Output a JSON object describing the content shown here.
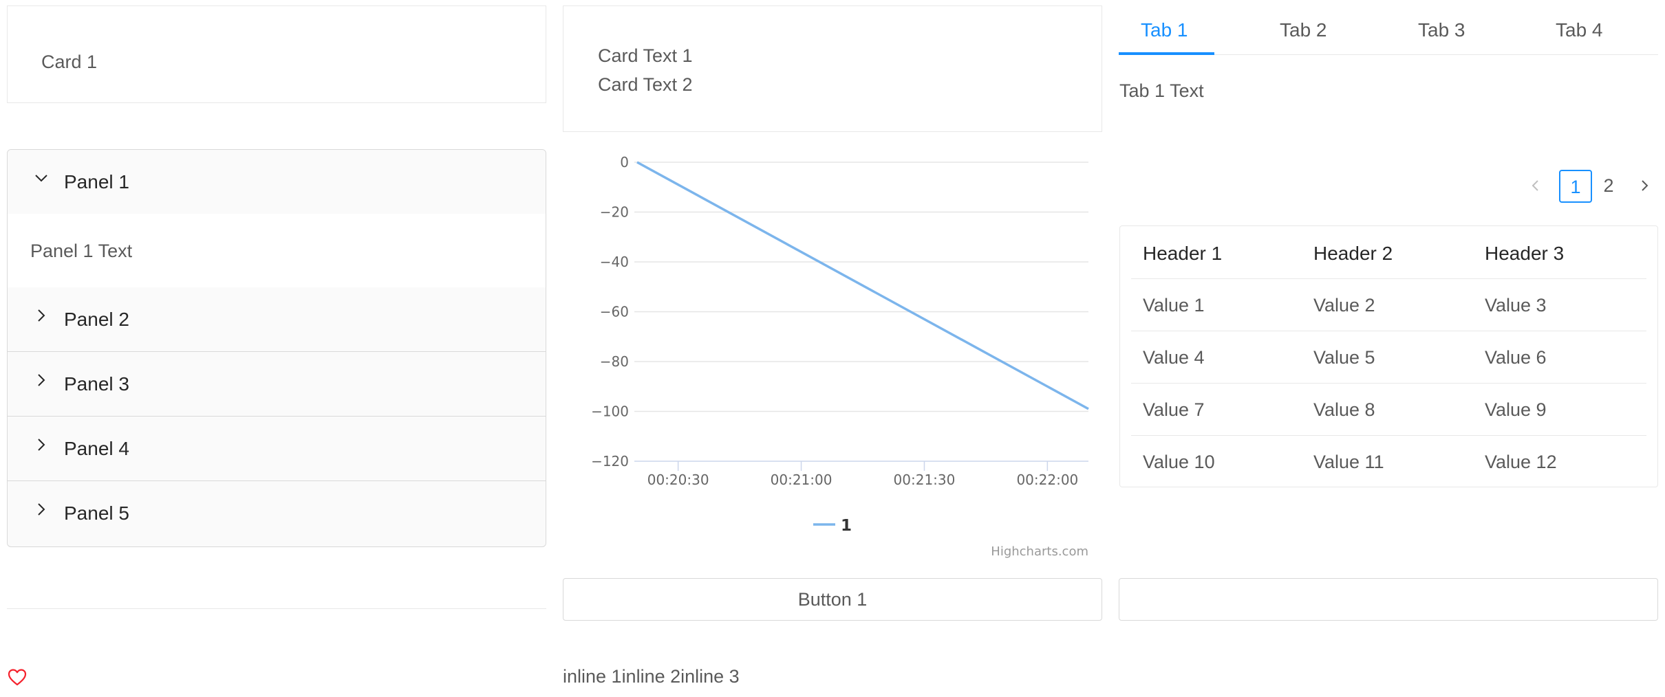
{
  "card1": {
    "title": "Card 1"
  },
  "collapse": {
    "panels": [
      {
        "label": "Panel 1",
        "expanded": true,
        "text": "Panel 1 Text"
      },
      {
        "label": "Panel 2",
        "expanded": false
      },
      {
        "label": "Panel 3",
        "expanded": false
      },
      {
        "label": "Panel 4",
        "expanded": false
      },
      {
        "label": "Panel 5",
        "expanded": false
      }
    ]
  },
  "card2": {
    "lines": [
      "Card Text 1",
      "Card Text 2"
    ]
  },
  "chart_data": {
    "type": "line",
    "x": [
      "00:20:20",
      "00:22:10"
    ],
    "series": [
      {
        "name": "1",
        "values": [
          0,
          -99
        ],
        "color": "#7cb5ec"
      }
    ],
    "x_tick_labels": [
      "00:20:30",
      "00:21:00",
      "00:21:30",
      "00:22:00"
    ],
    "y_tick_labels": [
      "0",
      "−20",
      "−40",
      "−60",
      "−80",
      "−100",
      "−120"
    ],
    "ylim": [
      -120,
      0
    ],
    "grid": true,
    "legend": "bottom-center",
    "credits": "Highcharts.com"
  },
  "button1": {
    "label": "Button 1"
  },
  "inline": {
    "items": [
      "inline 1",
      "inline 2",
      "inline 3"
    ]
  },
  "tabs": {
    "items": [
      "Tab 1",
      "Tab 2",
      "Tab 3",
      "Tab 4"
    ],
    "active": 0,
    "content": "Tab 1 Text",
    "accent": "#1890ff"
  },
  "pagination": {
    "pages": [
      "1",
      "2"
    ],
    "current": "1"
  },
  "table": {
    "headers": [
      "Header 1",
      "Header 2",
      "Header 3"
    ],
    "rows": [
      [
        "Value 1",
        "Value 2",
        "Value 3"
      ],
      [
        "Value 4",
        "Value 5",
        "Value 6"
      ],
      [
        "Value 7",
        "Value 8",
        "Value 9"
      ],
      [
        "Value 10",
        "Value 11",
        "Value 12"
      ]
    ]
  },
  "input1": {
    "value": "",
    "placeholder": ""
  },
  "icons": {
    "heart": "heart-icon",
    "heart_color": "#f5222d"
  }
}
